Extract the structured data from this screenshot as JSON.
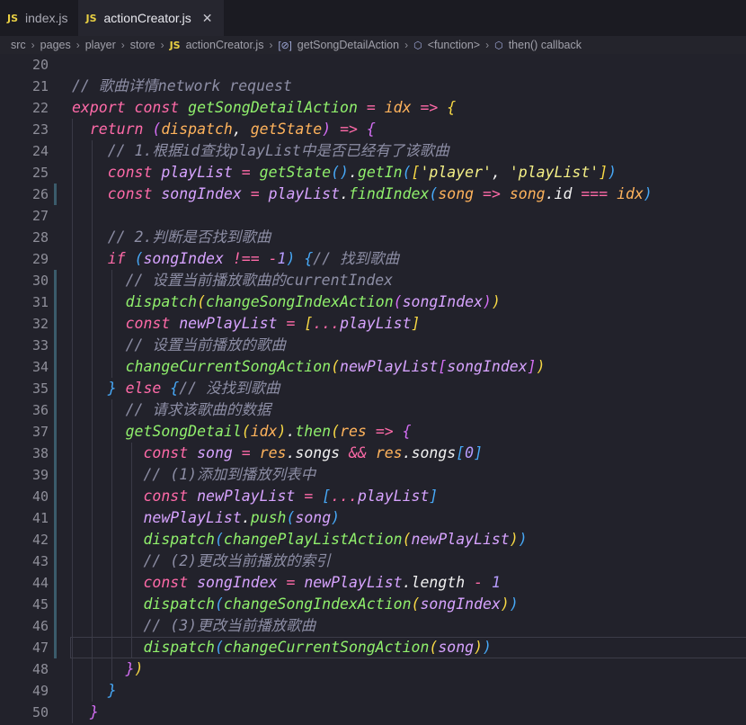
{
  "tabs": [
    {
      "badge": "JS",
      "label": "index.js"
    },
    {
      "badge": "JS",
      "label": "actionCreator.js",
      "close": "✕"
    }
  ],
  "breadcrumb": [
    "src",
    "pages",
    "player",
    "store",
    "JS",
    "actionCreator.js",
    "getSongDetailAction",
    "<function>",
    "then() callback"
  ],
  "lines": [
    {
      "n": "20",
      "t": []
    },
    {
      "n": "21",
      "t": [
        [
          "cm",
          "// 歌曲详情network request"
        ]
      ]
    },
    {
      "n": "22",
      "t": [
        [
          "kw",
          "export "
        ],
        [
          "kw",
          "const "
        ],
        [
          "fn",
          "getSongDetailAction "
        ],
        [
          "op",
          "= "
        ],
        [
          "prm",
          "idx "
        ],
        [
          "op",
          "=> "
        ],
        [
          "br1",
          "{"
        ]
      ]
    },
    {
      "n": "23",
      "t": [
        [
          "pl",
          "  "
        ],
        [
          "kw",
          "return "
        ],
        [
          "br2",
          "("
        ],
        [
          "prm",
          "dispatch"
        ],
        [
          "pl",
          ", "
        ],
        [
          "prm",
          "getState"
        ],
        [
          "br2",
          ")"
        ],
        [
          "op",
          " => "
        ],
        [
          "br2",
          "{"
        ]
      ]
    },
    {
      "n": "24",
      "t": [
        [
          "pl",
          "    "
        ],
        [
          "cm",
          "// 1.根据id查找playList中是否已经有了该歌曲"
        ]
      ]
    },
    {
      "n": "25",
      "t": [
        [
          "pl",
          "    "
        ],
        [
          "kw",
          "const "
        ],
        [
          "var",
          "playList "
        ],
        [
          "op",
          "= "
        ],
        [
          "fn",
          "getState"
        ],
        [
          "br3",
          "()"
        ],
        [
          "pl",
          "."
        ],
        [
          "fn",
          "getIn"
        ],
        [
          "br3",
          "("
        ],
        [
          "br1",
          "["
        ],
        [
          "str",
          "'player'"
        ],
        [
          "pl",
          ", "
        ],
        [
          "str",
          "'playList'"
        ],
        [
          "br1",
          "]"
        ],
        [
          "br3",
          ")"
        ]
      ]
    },
    {
      "n": "26",
      "t": [
        [
          "pl",
          "    "
        ],
        [
          "kw",
          "const "
        ],
        [
          "var",
          "songIndex "
        ],
        [
          "op",
          "= "
        ],
        [
          "var",
          "playList"
        ],
        [
          "pl",
          "."
        ],
        [
          "fn",
          "findIndex"
        ],
        [
          "br3",
          "("
        ],
        [
          "prm",
          "song "
        ],
        [
          "op",
          "=> "
        ],
        [
          "prm",
          "song"
        ],
        [
          "pl",
          "."
        ],
        [
          "prop",
          "id "
        ],
        [
          "op",
          "=== "
        ],
        [
          "prm",
          "idx"
        ],
        [
          "br3",
          ")"
        ]
      ]
    },
    {
      "n": "27",
      "t": []
    },
    {
      "n": "28",
      "t": [
        [
          "pl",
          "    "
        ],
        [
          "cm",
          "// 2.判断是否找到歌曲"
        ]
      ]
    },
    {
      "n": "29",
      "t": [
        [
          "pl",
          "    "
        ],
        [
          "kw",
          "if "
        ],
        [
          "br3",
          "("
        ],
        [
          "var",
          "songIndex "
        ],
        [
          "op",
          "!== "
        ],
        [
          "op",
          "-"
        ],
        [
          "num",
          "1"
        ],
        [
          "br3",
          ")"
        ],
        [
          "pl",
          " "
        ],
        [
          "br3",
          "{"
        ],
        [
          "cm",
          "// 找到歌曲"
        ]
      ]
    },
    {
      "n": "30",
      "t": [
        [
          "pl",
          "      "
        ],
        [
          "cm",
          "// 设置当前播放歌曲的currentIndex"
        ]
      ]
    },
    {
      "n": "31",
      "t": [
        [
          "pl",
          "      "
        ],
        [
          "fn",
          "dispatch"
        ],
        [
          "br1",
          "("
        ],
        [
          "fn",
          "changeSongIndexAction"
        ],
        [
          "br2",
          "("
        ],
        [
          "var",
          "songIndex"
        ],
        [
          "br2",
          ")"
        ],
        [
          "br1",
          ")"
        ]
      ]
    },
    {
      "n": "32",
      "t": [
        [
          "pl",
          "      "
        ],
        [
          "kw",
          "const "
        ],
        [
          "var",
          "newPlayList "
        ],
        [
          "op",
          "= "
        ],
        [
          "br1",
          "["
        ],
        [
          "op",
          "..."
        ],
        [
          "var",
          "playList"
        ],
        [
          "br1",
          "]"
        ]
      ]
    },
    {
      "n": "33",
      "t": [
        [
          "pl",
          "      "
        ],
        [
          "cm",
          "// 设置当前播放的歌曲"
        ]
      ]
    },
    {
      "n": "34",
      "t": [
        [
          "pl",
          "      "
        ],
        [
          "fn",
          "changeCurrentSongAction"
        ],
        [
          "br1",
          "("
        ],
        [
          "var",
          "newPlayList"
        ],
        [
          "br2",
          "["
        ],
        [
          "var",
          "songIndex"
        ],
        [
          "br2",
          "]"
        ],
        [
          "br1",
          ")"
        ]
      ]
    },
    {
      "n": "35",
      "t": [
        [
          "pl",
          "    "
        ],
        [
          "br3",
          "}"
        ],
        [
          "kw",
          " else "
        ],
        [
          "br3",
          "{"
        ],
        [
          "cm",
          "// 没找到歌曲"
        ]
      ]
    },
    {
      "n": "36",
      "t": [
        [
          "pl",
          "      "
        ],
        [
          "cm",
          "// 请求该歌曲的数据"
        ]
      ]
    },
    {
      "n": "37",
      "t": [
        [
          "pl",
          "      "
        ],
        [
          "fn",
          "getSongDetail"
        ],
        [
          "br1",
          "("
        ],
        [
          "prm",
          "idx"
        ],
        [
          "br1",
          ")"
        ],
        [
          "pl",
          "."
        ],
        [
          "fn",
          "then"
        ],
        [
          "br1",
          "("
        ],
        [
          "prm",
          "res "
        ],
        [
          "op",
          "=> "
        ],
        [
          "br2",
          "{"
        ]
      ]
    },
    {
      "n": "38",
      "t": [
        [
          "pl",
          "        "
        ],
        [
          "kw",
          "const "
        ],
        [
          "var",
          "song "
        ],
        [
          "op",
          "= "
        ],
        [
          "prm",
          "res"
        ],
        [
          "pl",
          "."
        ],
        [
          "prop",
          "songs "
        ],
        [
          "op",
          "&& "
        ],
        [
          "prm",
          "res"
        ],
        [
          "pl",
          "."
        ],
        [
          "prop",
          "songs"
        ],
        [
          "br3",
          "["
        ],
        [
          "num",
          "0"
        ],
        [
          "br3",
          "]"
        ]
      ]
    },
    {
      "n": "39",
      "t": [
        [
          "pl",
          "        "
        ],
        [
          "cm",
          "// (1)添加到播放列表中"
        ]
      ]
    },
    {
      "n": "40",
      "t": [
        [
          "pl",
          "        "
        ],
        [
          "kw",
          "const "
        ],
        [
          "var",
          "newPlayList "
        ],
        [
          "op",
          "= "
        ],
        [
          "br3",
          "["
        ],
        [
          "op",
          "..."
        ],
        [
          "var",
          "playList"
        ],
        [
          "br3",
          "]"
        ]
      ]
    },
    {
      "n": "41",
      "t": [
        [
          "pl",
          "        "
        ],
        [
          "var",
          "newPlayList"
        ],
        [
          "pl",
          "."
        ],
        [
          "fn",
          "push"
        ],
        [
          "br3",
          "("
        ],
        [
          "var",
          "song"
        ],
        [
          "br3",
          ")"
        ]
      ]
    },
    {
      "n": "42",
      "t": [
        [
          "pl",
          "        "
        ],
        [
          "fn",
          "dispatch"
        ],
        [
          "br3",
          "("
        ],
        [
          "fn",
          "changePlayListAction"
        ],
        [
          "br1",
          "("
        ],
        [
          "var",
          "newPlayList"
        ],
        [
          "br1",
          ")"
        ],
        [
          "br3",
          ")"
        ]
      ]
    },
    {
      "n": "43",
      "t": [
        [
          "pl",
          "        "
        ],
        [
          "cm",
          "// (2)更改当前播放的索引"
        ]
      ]
    },
    {
      "n": "44",
      "t": [
        [
          "pl",
          "        "
        ],
        [
          "kw",
          "const "
        ],
        [
          "var",
          "songIndex "
        ],
        [
          "op",
          "= "
        ],
        [
          "var",
          "newPlayList"
        ],
        [
          "pl",
          "."
        ],
        [
          "prop",
          "length "
        ],
        [
          "op",
          "- "
        ],
        [
          "num",
          "1"
        ]
      ]
    },
    {
      "n": "45",
      "t": [
        [
          "pl",
          "        "
        ],
        [
          "fn",
          "dispatch"
        ],
        [
          "br3",
          "("
        ],
        [
          "fn",
          "changeSongIndexAction"
        ],
        [
          "br1",
          "("
        ],
        [
          "var",
          "songIndex"
        ],
        [
          "br1",
          ")"
        ],
        [
          "br3",
          ")"
        ]
      ]
    },
    {
      "n": "46",
      "t": [
        [
          "pl",
          "        "
        ],
        [
          "cm",
          "// (3)更改当前播放歌曲"
        ]
      ]
    },
    {
      "n": "47",
      "t": [
        [
          "pl",
          "        "
        ],
        [
          "fn",
          "dispatch"
        ],
        [
          "br3",
          "("
        ],
        [
          "fn",
          "changeCurrentSongAction"
        ],
        [
          "br1",
          "("
        ],
        [
          "var",
          "song"
        ],
        [
          "br1",
          ")"
        ],
        [
          "br3",
          ")"
        ]
      ]
    },
    {
      "n": "48",
      "t": [
        [
          "pl",
          "      "
        ],
        [
          "br2",
          "}"
        ],
        [
          "br1",
          ")"
        ]
      ]
    },
    {
      "n": "49",
      "t": [
        [
          "pl",
          "    "
        ],
        [
          "br3",
          "}"
        ]
      ]
    },
    {
      "n": "50",
      "t": [
        [
          "pl",
          "  "
        ],
        [
          "br2",
          "}"
        ]
      ]
    }
  ]
}
